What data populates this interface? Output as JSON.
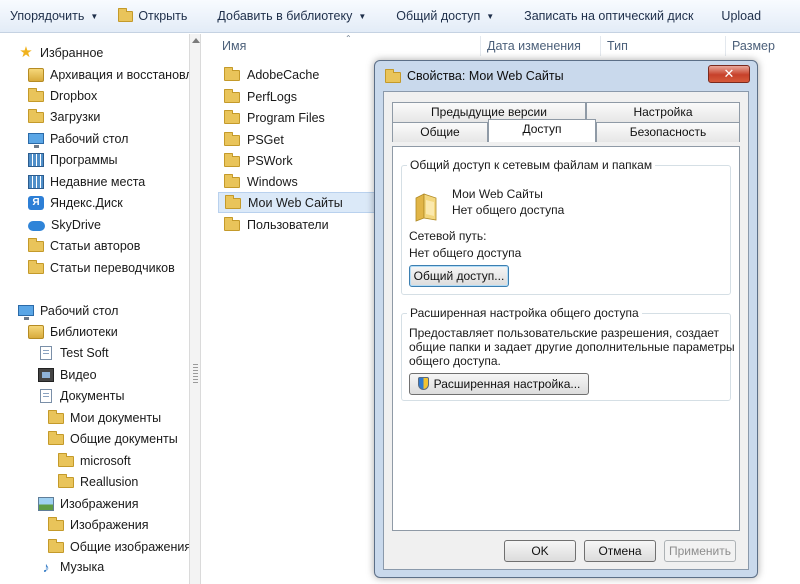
{
  "toolbar": {
    "organize": "Упорядочить",
    "open": "Открыть",
    "add_to_library": "Добавить в библиотеку",
    "share": "Общий доступ",
    "burn": "Записать на оптический диск",
    "upload": "Upload"
  },
  "nav": {
    "favorites": [
      "Избранное",
      "Архивация и восстановл",
      "Dropbox",
      "Загрузки",
      "Рабочий стол",
      "Программы",
      "Недавние места",
      "Яндекс.Диск",
      "SkyDrive",
      "Статьи авторов",
      "Статьи переводчиков"
    ],
    "desktop": "Рабочий стол",
    "libraries": "Библиотеки",
    "library_items": [
      "Test Soft",
      "Видео",
      "Документы",
      "Мои документы",
      "Общие документы",
      "microsoft",
      "Reallusion",
      "Изображения",
      "Изображения",
      "Общие изображения",
      "Музыка"
    ]
  },
  "columns": {
    "name": "Имя",
    "date": "Дата изменения",
    "type": "Тип",
    "size": "Размер"
  },
  "files": [
    "AdobeCache",
    "PerfLogs",
    "Program Files",
    "PSGet",
    "PSWork",
    "Windows",
    "Мои Web Сайты",
    "Пользователи"
  ],
  "dialog": {
    "title": "Свойства: Мои Web Сайты",
    "close": "✕",
    "tabs_top": [
      "Предыдущие версии",
      "Настройка"
    ],
    "tabs_bottom": [
      "Общие",
      "Доступ",
      "Безопасность"
    ],
    "group1_title": "Общий доступ к сетевым файлам и папкам",
    "folder_name": "Мои Web Сайты",
    "folder_status": "Нет общего доступа",
    "net_path_label": "Сетевой путь:",
    "net_path_value": "Нет общего доступа",
    "share_button": "Общий доступ...",
    "group2_title": "Расширенная настройка общего доступа",
    "adv_line1": "Предоставляет пользовательские разрешения, создает",
    "adv_line2": "общие папки и задает другие дополнительные параметры",
    "adv_line3": "общего доступа.",
    "adv_button": "Расширенная настройка...",
    "ok": "OK",
    "cancel": "Отмена",
    "apply": "Применить"
  },
  "colors": {
    "selection": "#dbe9f8",
    "dialog_frame": "#c9d9ec",
    "folder": "#e9c45a"
  }
}
